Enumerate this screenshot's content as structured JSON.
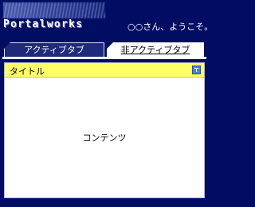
{
  "header": {
    "logo_text": "Portalworks",
    "welcome_text": "○○さん、ようこそ。"
  },
  "tabs": [
    {
      "label": "アクティブタブ",
      "active": true
    },
    {
      "label": "非アクティブタブ",
      "active": false
    }
  ],
  "portlet": {
    "title": "タイトル",
    "content": "コンテンツ",
    "title_bar_color": "#ffff66",
    "button_icon": "minimize-icon"
  },
  "colors": {
    "background": "#000d63",
    "active_tab": "#1f2a7c",
    "inactive_tab": "#ffffff"
  }
}
